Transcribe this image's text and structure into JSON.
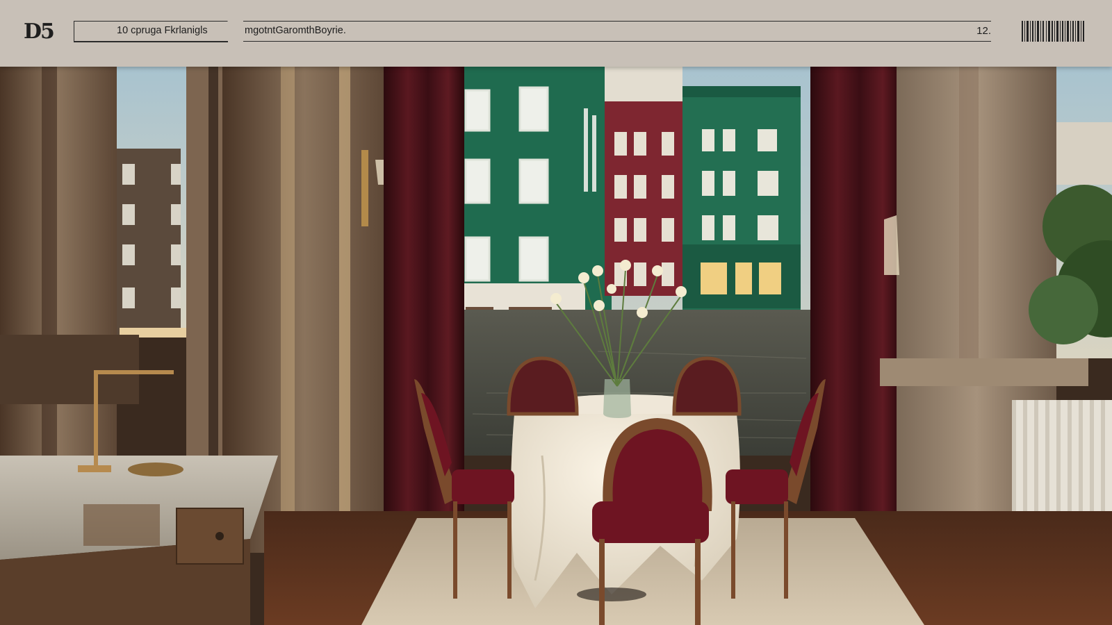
{
  "toolbar": {
    "logo_text": "D5",
    "left_field_label": "10 cpruga Fkrlanigls",
    "main_field_text": "mgotntGaromthBoyrie.",
    "main_field_count": "12.",
    "barcode_icon": "barcode-icon"
  },
  "scene": {
    "description_icon": "restaurant-photo",
    "colors": {
      "green_building": "#1f6b4f",
      "red_building": "#7e2630",
      "curtain": "#4a1218",
      "chair_velvet": "#6e1422",
      "tablecloth": "#efe7d8",
      "stone": "#8d7762"
    }
  }
}
